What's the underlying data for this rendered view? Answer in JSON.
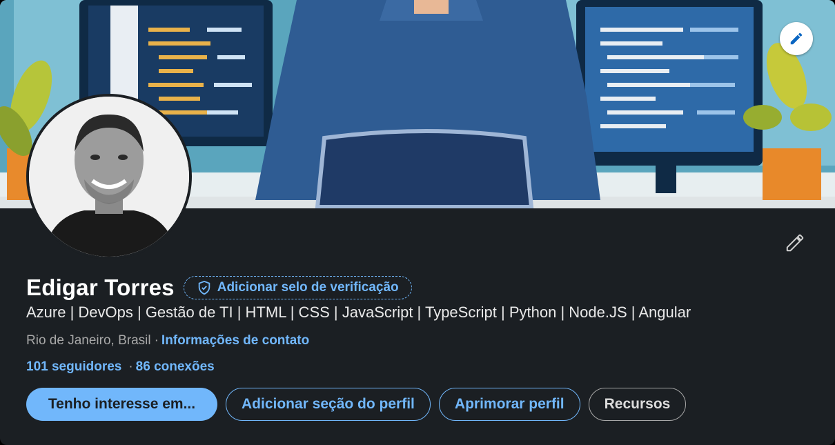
{
  "profile": {
    "name": "Edigar Torres",
    "verification_label": "Adicionar selo de verificação",
    "headline": "Azure | DevOps | Gestão de TI | HTML | CSS | JavaScript | TypeScript | Python | Node.JS | Angular",
    "location": "Rio de Janeiro, Brasil",
    "separator": "·",
    "contact_link": "Informações de contato",
    "followers": "101 seguidores",
    "connections": "86 conexões"
  },
  "actions": {
    "open_to": "Tenho interesse em...",
    "add_section": "Adicionar seção do perfil",
    "enhance": "Aprimorar perfil",
    "resources": "Recursos"
  },
  "icons": {
    "banner_edit": "pencil-icon",
    "intro_edit": "pencil-icon",
    "verification": "shield-check-icon"
  },
  "colors": {
    "accent": "#71b7fb",
    "card_background": "#1b1f23",
    "text_primary": "#ffffff",
    "text_secondary": "#a8a8a8"
  }
}
